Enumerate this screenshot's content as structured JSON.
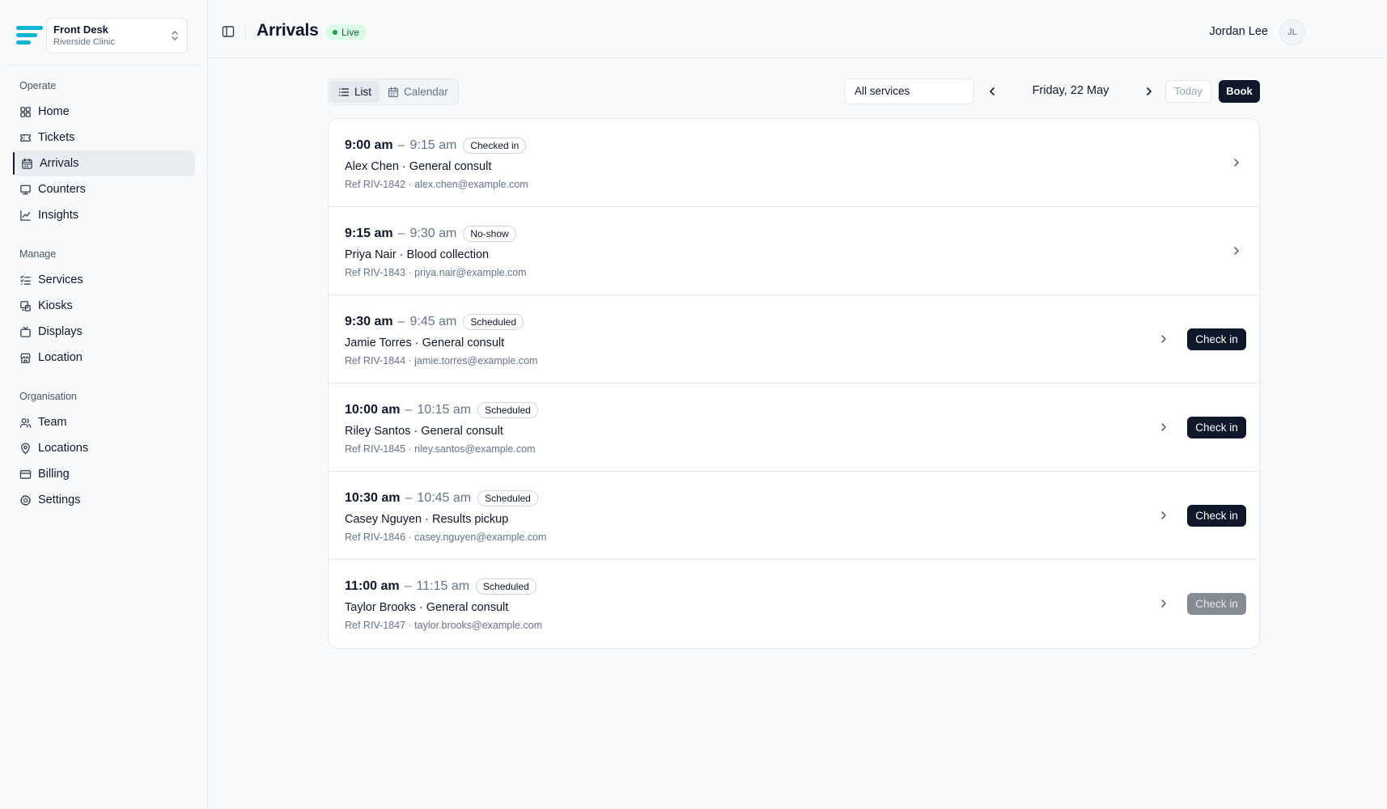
{
  "sidebar": {
    "org_name": "Front Desk",
    "org_location": "Riverside Clinic",
    "sections": [
      {
        "title": "Operate",
        "items": [
          {
            "label": "Home",
            "icon": "home-grid-icon"
          },
          {
            "label": "Tickets",
            "icon": "ticket-icon"
          },
          {
            "label": "Arrivals",
            "icon": "calendar-icon",
            "active": true
          },
          {
            "label": "Counters",
            "icon": "monitor-icon"
          },
          {
            "label": "Insights",
            "icon": "line-chart-icon"
          }
        ]
      },
      {
        "title": "Manage",
        "items": [
          {
            "label": "Services",
            "icon": "list-checks-icon"
          },
          {
            "label": "Kiosks",
            "icon": "kiosk-icon"
          },
          {
            "label": "Displays",
            "icon": "tv-icon"
          },
          {
            "label": "Location",
            "icon": "store-icon"
          }
        ]
      },
      {
        "title": "Organisation",
        "items": [
          {
            "label": "Team",
            "icon": "users-icon"
          },
          {
            "label": "Locations",
            "icon": "map-pin-icon"
          },
          {
            "label": "Billing",
            "icon": "credit-card-icon"
          },
          {
            "label": "Settings",
            "icon": "gear-icon"
          }
        ]
      }
    ]
  },
  "header": {
    "title": "Arrivals",
    "live_label": "Live",
    "user_name": "Jordan Lee",
    "user_initials": "JL"
  },
  "toolbar": {
    "views": [
      {
        "label": "List",
        "active": true
      },
      {
        "label": "Calendar",
        "active": false
      }
    ],
    "service_filter": "All services",
    "date": "Friday, 22 May",
    "today_label": "Today",
    "book_label": "Book"
  },
  "arrivals": [
    {
      "start": "9:00 am",
      "end": "9:15 am",
      "status": "Checked in",
      "patient_service": "Alex Chen · General consult",
      "meta": "Ref RIV-1842 · alex.chen@example.com",
      "action": null
    },
    {
      "start": "9:15 am",
      "end": "9:30 am",
      "status": "No-show",
      "patient_service": "Priya Nair · Blood collection",
      "meta": "Ref RIV-1843 · priya.nair@example.com",
      "action": null
    },
    {
      "start": "9:30 am",
      "end": "9:45 am",
      "status": "Scheduled",
      "patient_service": "Jamie Torres · General consult",
      "meta": "Ref RIV-1844 · jamie.torres@example.com",
      "action": "Check in",
      "action_disabled": false
    },
    {
      "start": "10:00 am",
      "end": "10:15 am",
      "status": "Scheduled",
      "patient_service": "Riley Santos · General consult",
      "meta": "Ref RIV-1845 · riley.santos@example.com",
      "action": "Check in",
      "action_disabled": false
    },
    {
      "start": "10:30 am",
      "end": "10:45 am",
      "status": "Scheduled",
      "patient_service": "Casey Nguyen · Results pickup",
      "meta": "Ref RIV-1846 · casey.nguyen@example.com",
      "action": "Check in",
      "action_disabled": false
    },
    {
      "start": "11:00 am",
      "end": "11:15 am",
      "status": "Scheduled",
      "patient_service": "Taylor Brooks · General consult",
      "meta": "Ref RIV-1847 · taylor.brooks@example.com",
      "action": "Check in",
      "action_disabled": true
    }
  ],
  "colors": {
    "accent": "#06b6d4",
    "primary": "#0f172a",
    "live_bg": "#dcfce7",
    "live_dot": "#16a34a"
  }
}
